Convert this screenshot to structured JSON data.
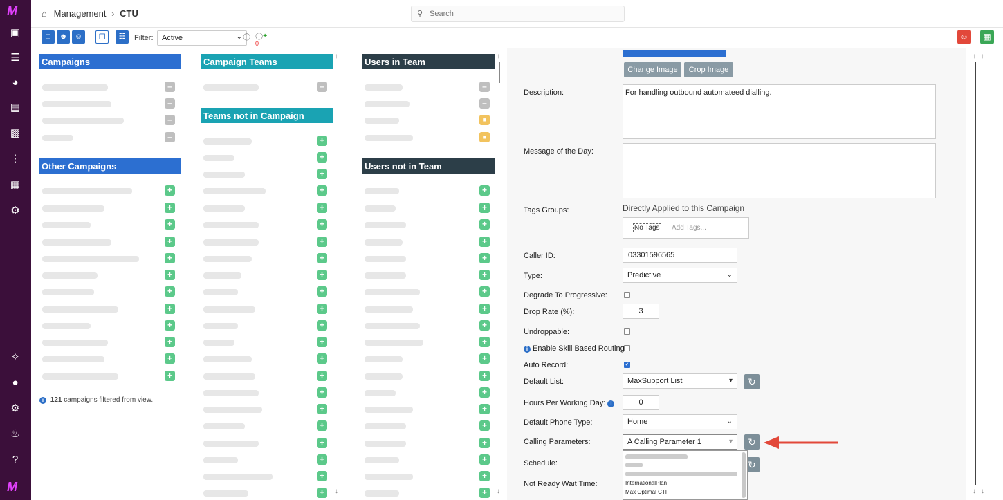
{
  "nav": {
    "logo": "M",
    "icons": [
      "briefcase-icon",
      "sliders-icon",
      "gauge-icon",
      "database-icon",
      "contact-card-icon",
      "waveform-icon",
      "report-icon",
      "cogs-icon"
    ],
    "bottom_icons": [
      "puzzle-icon",
      "headset-user-icon",
      "gear-icon",
      "bell-icon",
      "help-icon"
    ]
  },
  "header": {
    "breadcrumb_root": "Management",
    "breadcrumb_sep": "›",
    "breadcrumb_current": "CTU",
    "search_placeholder": "Search"
  },
  "toolbar": {
    "filter_label": "Filter:",
    "filter_value": "Active",
    "tag_count": "0"
  },
  "campaigns": {
    "title": "Campaigns",
    "other_title": "Other Campaigns",
    "filtered_count": "121",
    "filtered_text": "campaigns filtered from view."
  },
  "teams": {
    "campaign_teams_title": "Campaign Teams",
    "not_in_campaign_title": "Teams not in Campaign"
  },
  "users": {
    "in_team_title": "Users in Team",
    "not_in_team_title": "Users not in Team"
  },
  "form": {
    "change_image": "Change Image",
    "crop_image": "Crop Image",
    "description_label": "Description:",
    "description_value": "For handling outbound automateed dialling.",
    "motd_label": "Message of the Day:",
    "tags_groups_label": "Tags Groups:",
    "directly_applied": "Directly Applied to this Campaign",
    "no_tags": "No Tags",
    "add_tags_placeholder": "Add Tags...",
    "caller_id_label": "Caller ID:",
    "caller_id_value": "03301596565",
    "type_label": "Type:",
    "type_value": "Predictive",
    "degrade_label": "Degrade To Progressive:",
    "drop_rate_label": "Drop Rate (%):",
    "drop_rate_value": "3",
    "undroppable_label": "Undroppable:",
    "skill_routing_label": "Enable Skill Based Routing:",
    "auto_record_label": "Auto Record:",
    "default_list_label": "Default List:",
    "default_list_value": "MaxSupport List",
    "hours_label": "Hours Per Working Day:",
    "hours_value": "0",
    "phone_type_label": "Default Phone Type:",
    "phone_type_value": "Home",
    "calling_params_label": "Calling Parameters:",
    "calling_params_value": "A Calling Parameter 1",
    "schedule_label": "Schedule:",
    "not_ready_label": "Not Ready Wait Time:",
    "dropdown_options": [
      "InternationalPlan",
      "Max Optimal CTI"
    ]
  },
  "colors": {
    "nav_bg": "#3b0f3a",
    "primary_blue": "#2c6fd1",
    "teal": "#1aa3b3",
    "dark_slate": "#2c3e48",
    "add_green": "#5cc98a",
    "arrow_red": "#e2483a"
  }
}
